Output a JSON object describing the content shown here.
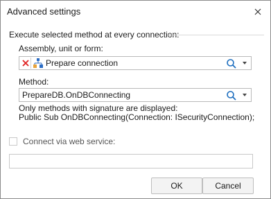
{
  "dialog": {
    "title": "Advanced settings"
  },
  "section": {
    "label": "Execute selected method at every connection:"
  },
  "assembly": {
    "label": "Assembly, unit or form:",
    "value": "Prepare connection"
  },
  "method": {
    "label": "Method:",
    "value": "PrepareDB.OnDBConnecting",
    "info_line1": "Only methods with signature are displayed:",
    "info_line2": "Public Sub OnDBConnecting(Connection: ISecurityConnection);"
  },
  "web_service": {
    "label": "Connect via web service:",
    "checked": false,
    "url_value": ""
  },
  "buttons": {
    "ok": "OK",
    "cancel": "Cancel"
  },
  "colors": {
    "clear_icon": "#e02020",
    "search_icon": "#1f6fbf",
    "unit_icon_blue": "#2b6cc4",
    "unit_icon_orange": "#e8a33a"
  }
}
